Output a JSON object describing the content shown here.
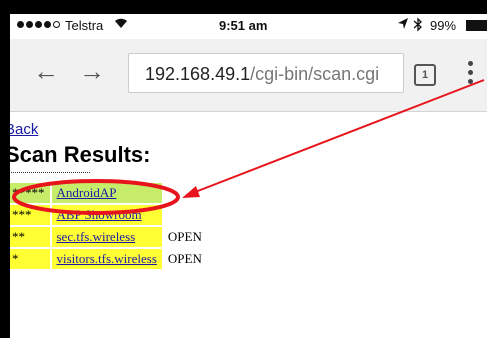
{
  "status_bar": {
    "carrier": "Telstra",
    "time": "9:51 am",
    "battery": "99%"
  },
  "browser": {
    "url_host": "192.168.49.1",
    "url_path": "/cgi-bin/scan.cgi",
    "tab_count": "1"
  },
  "page": {
    "back_link": "Back",
    "title": "Scan Results:",
    "results": [
      {
        "stars": "*****",
        "ssid": "AndroidAP",
        "security": "",
        "color": "#c6ec6a"
      },
      {
        "stars": "***",
        "ssid": "ABP Showroom",
        "security": "",
        "color": "#ffff33"
      },
      {
        "stars": "**",
        "ssid": "sec.tfs.wireless",
        "security": "OPEN",
        "color": "#ffff33"
      },
      {
        "stars": "*",
        "ssid": "visitors.tfs.wireless",
        "security": "OPEN",
        "color": "#ffff33"
      }
    ]
  },
  "annotation": {
    "color": "#e8141c"
  }
}
